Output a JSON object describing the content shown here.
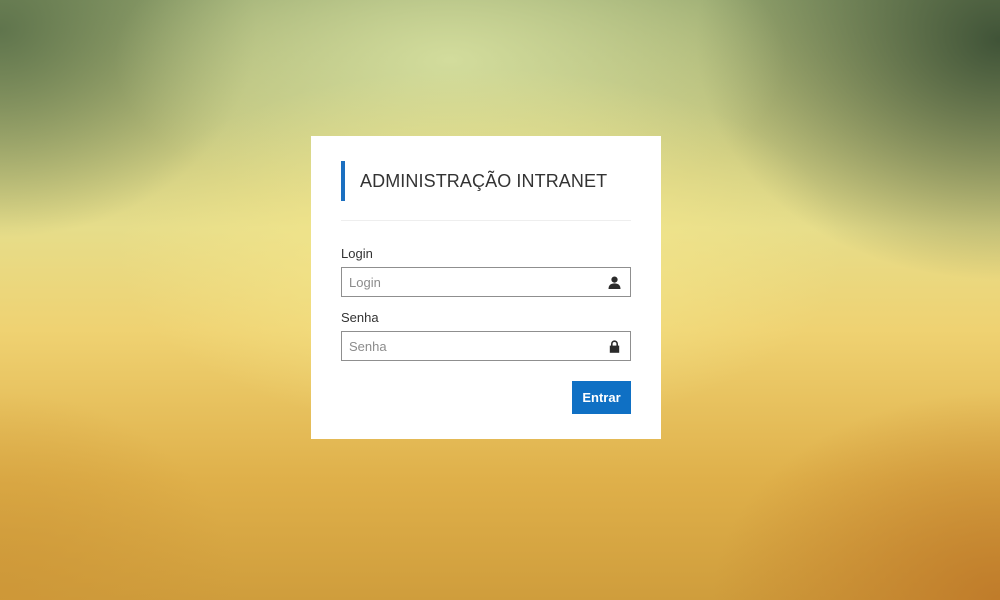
{
  "login_card": {
    "title": "ADMINISTRAÇÃO INTRANET",
    "login": {
      "label": "Login",
      "placeholder": "Login",
      "value": "",
      "icon": "user-icon"
    },
    "password": {
      "label": "Senha",
      "placeholder": "Senha",
      "value": "",
      "icon": "lock-icon"
    },
    "submit_label": "Entrar"
  },
  "colors": {
    "accent": "#1b6fc0",
    "button": "#0f70c4",
    "card_background": "#ffffff"
  }
}
